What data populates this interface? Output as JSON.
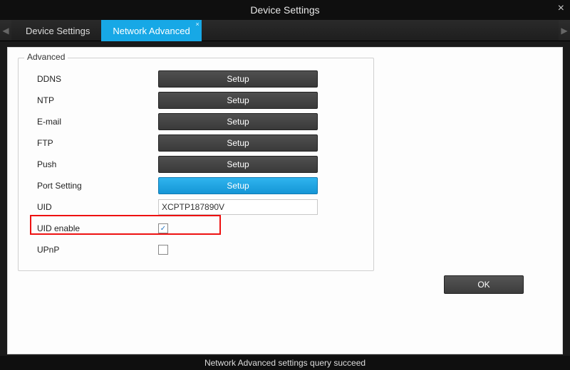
{
  "window": {
    "title": "Device Settings"
  },
  "tabs": {
    "device_settings": "Device Settings",
    "network_advanced": "Network Advanced"
  },
  "panel": {
    "legend": "Advanced",
    "rows": {
      "ddns": {
        "label": "DDNS",
        "btn": "Setup"
      },
      "ntp": {
        "label": "NTP",
        "btn": "Setup"
      },
      "email": {
        "label": "E-mail",
        "btn": "Setup"
      },
      "ftp": {
        "label": "FTP",
        "btn": "Setup"
      },
      "push": {
        "label": "Push",
        "btn": "Setup"
      },
      "port": {
        "label": "Port Setting",
        "btn": "Setup"
      },
      "uid": {
        "label": "UID",
        "value": "XCPTP187890V"
      },
      "uid_en": {
        "label": "UID enable",
        "checked": true
      },
      "upnp": {
        "label": "UPnP",
        "checked": false
      }
    }
  },
  "buttons": {
    "ok": "OK"
  },
  "status": "Network Advanced settings query succeed"
}
